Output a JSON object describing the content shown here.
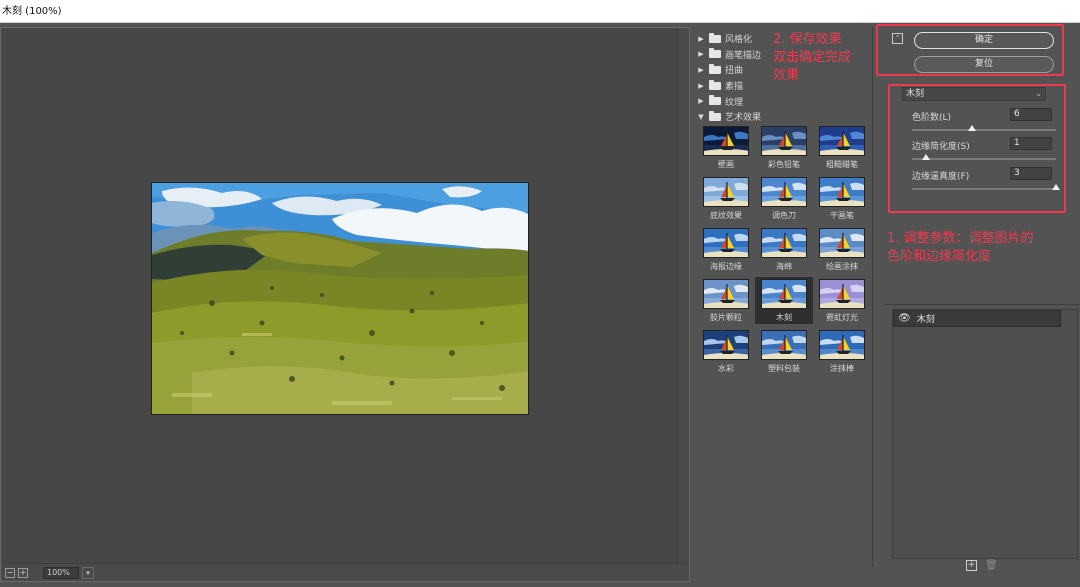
{
  "window": {
    "title": "木刻 (100%)"
  },
  "preview": {
    "zoom": "100%"
  },
  "filter_gallery": {
    "categories": [
      {
        "label": "风格化",
        "expanded": false
      },
      {
        "label": "画笔描边",
        "expanded": false
      },
      {
        "label": "扭曲",
        "expanded": false
      },
      {
        "label": "素描",
        "expanded": false
      },
      {
        "label": "纹理",
        "expanded": false
      },
      {
        "label": "艺术效果",
        "expanded": true
      }
    ],
    "thumbnails": [
      {
        "label": "壁画",
        "selected": false
      },
      {
        "label": "彩色铅笔",
        "selected": false
      },
      {
        "label": "粗糙蜡笔",
        "selected": false
      },
      {
        "label": "底纹效果",
        "selected": false
      },
      {
        "label": "调色刀",
        "selected": false
      },
      {
        "label": "干画笔",
        "selected": false
      },
      {
        "label": "海报边缘",
        "selected": false
      },
      {
        "label": "海绵",
        "selected": false
      },
      {
        "label": "绘画涂抹",
        "selected": false
      },
      {
        "label": "胶片颗粒",
        "selected": false
      },
      {
        "label": "木刻",
        "selected": true
      },
      {
        "label": "霓虹灯光",
        "selected": false
      },
      {
        "label": "水彩",
        "selected": false
      },
      {
        "label": "塑料包装",
        "selected": false
      },
      {
        "label": "涂抹棒",
        "selected": false
      }
    ]
  },
  "settings": {
    "ok_label": "确定",
    "reset_label": "复位",
    "filter_select": "木刻",
    "params": [
      {
        "label": "色阶数(L)",
        "value": "6",
        "slider_fraction": 0.42
      },
      {
        "label": "边缘简化度(S)",
        "value": "1",
        "slider_fraction": 0.1
      },
      {
        "label": "边缘逼真度(F)",
        "value": "3",
        "slider_fraction": 1.0
      }
    ],
    "layer_label": "木刻"
  },
  "annotations": {
    "step2_line1": "2. 保存效果",
    "step2_line2": "双击确定完成",
    "step2_line3": "效果",
    "step1_line1": "1. 调整参数：调整图片的",
    "step1_line2": "色阶和边缘简化度"
  },
  "colors": {
    "annotation": "#f0394f",
    "panel": "#535353",
    "preview_bg": "#474747"
  }
}
